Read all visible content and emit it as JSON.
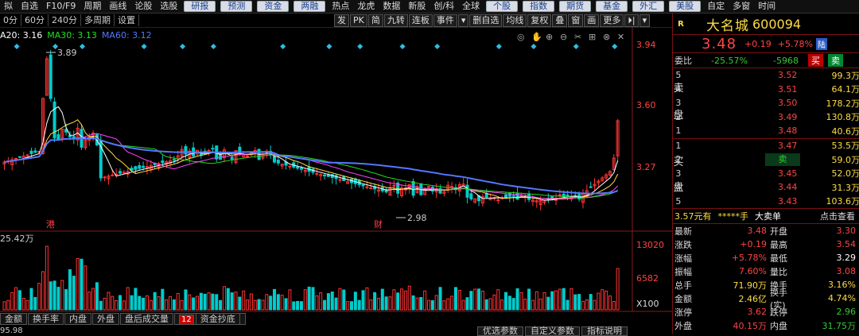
{
  "topbar": {
    "items": [
      "拟",
      "自选",
      "F10/F9",
      "周期",
      "画线",
      "论股",
      "选股"
    ],
    "buttons": [
      "研报",
      "预测",
      "资金",
      "两融"
    ],
    "items2": [
      "热点",
      "龙虎",
      "数据",
      "新股",
      "创/科",
      "全球"
    ],
    "buttons2": [
      "个股",
      "指数",
      "期货",
      "基金",
      "外汇",
      "美股"
    ],
    "items3": [
      "自定",
      "多窗",
      "时间"
    ]
  },
  "periods": [
    "0分",
    "60分",
    "240分",
    "多周期",
    "设置"
  ],
  "tools": [
    "发",
    "PK",
    "简",
    "九转",
    "连板",
    "事件",
    "▾",
    "删自选",
    "均线",
    "复权",
    "叠",
    "窗",
    "画",
    "更多",
    "⏵|",
    "▾"
  ],
  "ma_legend": [
    {
      "label": "A20: 3.16",
      "color": "#ffffff"
    },
    {
      "label": "MA30: 3.13",
      "color": "#22dd22"
    },
    {
      "label": "MA60: 3.12",
      "color": "#5577ff"
    }
  ],
  "chart_data": {
    "type": "candlestick",
    "y_ticks": [
      "3.94",
      "3.60",
      "3.27"
    ],
    "high_label": "3.89",
    "low_label": "2.98",
    "event_marks": [
      "港",
      "财"
    ],
    "vol_label": "25.42万",
    "vol_ticks": [
      "13020",
      "6582",
      "X100"
    ]
  },
  "bottom_tabs": [
    "金额",
    "换手率",
    "内盘",
    "外盘",
    "盘后成交量",
    "资金抄底"
  ],
  "bottom_badge": "12",
  "bottom_row": "95.98",
  "bottom_buttons": [
    "优选参数",
    "自定义参数",
    "指标说明"
  ],
  "stock": {
    "flag": "R",
    "name": "大名城",
    "code": "600094",
    "price": "3.48",
    "change": "+0.19",
    "pct": "+5.78%",
    "lu": "陆"
  },
  "weibi": {
    "label": "委比",
    "ratio": "-25.57%",
    "diff": "-5968",
    "buy": "买",
    "sell": "卖"
  },
  "asks": [
    {
      "lv": "5",
      "price": "3.52",
      "vol": "99.3万"
    },
    {
      "lv": "4",
      "price": "3.51",
      "vol": "64.1万"
    },
    {
      "lv": "3",
      "price": "3.50",
      "vol": "178.2万"
    },
    {
      "lv": "2",
      "price": "3.49",
      "vol": "130.8万"
    },
    {
      "lv": "1",
      "price": "3.48",
      "vol": "40.6万"
    }
  ],
  "bids": [
    {
      "lv": "1",
      "price": "3.47",
      "vol": "53.5万"
    },
    {
      "lv": "2",
      "price": "3.46",
      "vol": "59.0万"
    },
    {
      "lv": "3",
      "price": "3.45",
      "vol": "52.0万"
    },
    {
      "lv": "4",
      "price": "3.44",
      "vol": "31.3万"
    },
    {
      "lv": "5",
      "price": "3.43",
      "vol": "103.6万"
    }
  ],
  "ask_side": [
    "卖",
    "盘"
  ],
  "bid_side": [
    "买",
    "盘"
  ],
  "bid_tag": "卖",
  "info": {
    "left": "3.57元有",
    "stars": "*****手",
    "mid": "大卖单",
    "right": "点击查看"
  },
  "stats": [
    {
      "k": "最新",
      "v": "3.48",
      "vc": "red",
      "k2": "开盘",
      "v2": "3.30",
      "v2c": "red"
    },
    {
      "k": "涨跌",
      "v": "+0.19",
      "vc": "red",
      "k2": "最高",
      "v2": "3.54",
      "v2c": "red"
    },
    {
      "k": "涨幅",
      "v": "+5.78%",
      "vc": "red",
      "k2": "最低",
      "v2": "3.29",
      "v2c": "wht"
    },
    {
      "k": "振幅",
      "v": "7.60%",
      "vc": "red",
      "k2": "量比",
      "v2": "3.08",
      "v2c": "red"
    },
    {
      "k": "总手",
      "v": "71.90万",
      "vc": "yel",
      "k2": "换手",
      "v2": "3.16%",
      "v2c": "yel"
    },
    {
      "k": "金额",
      "v": "2.46亿",
      "vc": "yel",
      "k2": "换手(实)",
      "v2": "4.74%",
      "v2c": "yel"
    },
    {
      "k": "涨停",
      "v": "3.62",
      "vc": "red",
      "k2": "跌停",
      "v2": "2.96",
      "v2c": "grn"
    },
    {
      "k": "外盘",
      "v": "40.15万",
      "vc": "red",
      "k2": "内盘",
      "v2": "31.75万",
      "v2c": "grn"
    }
  ]
}
